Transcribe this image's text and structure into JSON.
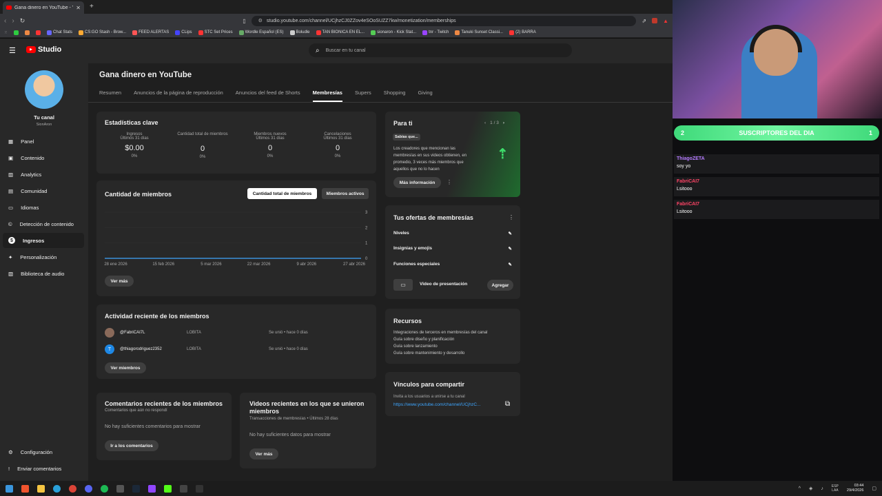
{
  "browser": {
    "tab_title": "Gana dinero en YouTube - YouT",
    "new_tab": "+",
    "url": "studio.youtube.com/channel/UCjhzCJ0ZZov4eSOoSUZZ7kw/monetization/memberships",
    "bookmarks": [
      "Chat Stats",
      "CS:GO Stash - Brow...",
      "FEED ALERTAS",
      "CLips",
      "STC Set Prices",
      "Wordle Español (ES)",
      "Boludle",
      "TAN BIONICA EN EL...",
      "sionaron - Kick Stat...",
      "tnr - Twitch",
      "Tanuki Sunset Classi...",
      "(2) BARRA"
    ]
  },
  "header": {
    "logo_text": "Studio",
    "search_placeholder": "Buscar en tu canal"
  },
  "sidebar": {
    "channel_title": "Tu canal",
    "channel_name": "SionAron",
    "items": [
      {
        "label": "Panel",
        "icon": "dashboard-icon"
      },
      {
        "label": "Contenido",
        "icon": "content-icon"
      },
      {
        "label": "Analytics",
        "icon": "analytics-icon"
      },
      {
        "label": "Comunidad",
        "icon": "community-icon"
      },
      {
        "label": "Idiomas",
        "icon": "subtitles-icon"
      },
      {
        "label": "Detección de contenido",
        "icon": "copyright-icon"
      },
      {
        "label": "Ingresos",
        "icon": "dollar-icon"
      },
      {
        "label": "Personalización",
        "icon": "magic-wand-icon"
      },
      {
        "label": "Biblioteca de audio",
        "icon": "audio-library-icon"
      }
    ],
    "bottom": [
      {
        "label": "Configuración",
        "icon": "gear-icon"
      },
      {
        "label": "Enviar comentarios",
        "icon": "feedback-icon"
      }
    ]
  },
  "main": {
    "title": "Gana dinero en YouTube",
    "tabs": [
      "Resumen",
      "Anuncios de la página de reproducción",
      "Anuncios del feed de Shorts",
      "Membresías",
      "Supers",
      "Shopping",
      "Giving"
    ],
    "stats": {
      "title": "Estadísticas clave",
      "items": [
        {
          "label": "Ingresos",
          "period": "Últimos 31 días",
          "value": "$0.00",
          "change": "0%"
        },
        {
          "label": "Cantidad total de miembros",
          "period": "",
          "value": "0",
          "change": "0%"
        },
        {
          "label": "Miembros nuevos",
          "period": "Últimos 31 días",
          "value": "0",
          "change": "0%"
        },
        {
          "label": "Cancelaciones",
          "period": "Últimos 31 días",
          "value": "0",
          "change": "0%"
        }
      ]
    },
    "members_chart": {
      "title": "Cantidad de miembros",
      "toggle_total": "Cantidad total de miembros",
      "toggle_active": "Miembros activos",
      "see_more": "Ver más"
    },
    "recent_activity": {
      "title": "Actividad reciente de los miembros",
      "rows": [
        {
          "user": "@FabriCAI7L",
          "level": "LOBITA",
          "status": "Se unió • hace 0 días",
          "avatar_letter": ""
        },
        {
          "user": "@thiagorodriguez2352",
          "level": "LOBITA",
          "status": "Se unió • hace 0 días",
          "avatar_letter": "T"
        }
      ],
      "see_members": "Ver miembros"
    },
    "recent_comments": {
      "title": "Comentarios recientes de los miembros",
      "subtitle": "Comentarios que aún no respondí",
      "empty": "No hay suficientes comentarios para mostrar",
      "button": "Ir a los comentarios"
    },
    "recent_videos": {
      "title": "Videos recientes en los que se unieron miembros",
      "subtitle": "Transacciones de membresías • Últimos 28 días",
      "empty": "No hay suficientes datos para mostrar",
      "button": "Ver más"
    },
    "para_ti": {
      "title": "Para ti",
      "pager": "1 / 3",
      "chip": "Sabías que...",
      "text": "Los creadores que mencionan las membresías en sus videos obtienen, en promedio, 3 veces más miembros que aquellos que no lo hacen",
      "button": "Más información"
    },
    "offers": {
      "title": "Tus ofertas de membresías",
      "items": [
        "Niveles",
        "Insignias y emojis",
        "Funciones especiales"
      ],
      "video_label": "Video de presentación",
      "add": "Agregar"
    },
    "recursos": {
      "title": "Recursos",
      "links": [
        "Integraciones de terceros en membresías del canal",
        "Guía sobre diseño y planificación",
        "Guía sobre lanzamiento",
        "Guía sobre mantenimiento y desarrollo"
      ]
    },
    "share": {
      "title": "Vínculos para compartir",
      "subtitle": "Invita a los usuarios a unirse a tu canal",
      "link": "https://www.youtube.com/channel/UCjhzC..."
    }
  },
  "chart_data": {
    "type": "line",
    "title": "Cantidad de miembros",
    "x": [
      "28 ene 2026",
      "15 feb 2026",
      "5 mar 2026",
      "22 mar 2026",
      "9 abr 2026",
      "27 abr 2026"
    ],
    "series": [
      {
        "values": [
          0,
          0,
          0,
          0,
          0,
          0
        ]
      }
    ],
    "y_ticks": [
      "3",
      "2",
      "1",
      "0"
    ],
    "ylim": [
      0,
      3
    ],
    "grid": true
  },
  "stream": {
    "banner_label": "SUSCRIPTORES DEL DIA",
    "banner_left": "2",
    "banner_right": "1",
    "messages": [
      {
        "user": "ThiagoZETA",
        "text": "soy yo",
        "color": "#b57bff"
      },
      {
        "user": "FabriCAI7",
        "text": "Lsitooo",
        "color": "#ff4466"
      },
      {
        "user": "FabriCAI7",
        "text": "Lsitooo",
        "color": "#ff4466"
      }
    ]
  },
  "taskbar": {
    "lang": "ESP",
    "lang2": "LAA",
    "time": "03:44",
    "date": "29/4/2026"
  }
}
